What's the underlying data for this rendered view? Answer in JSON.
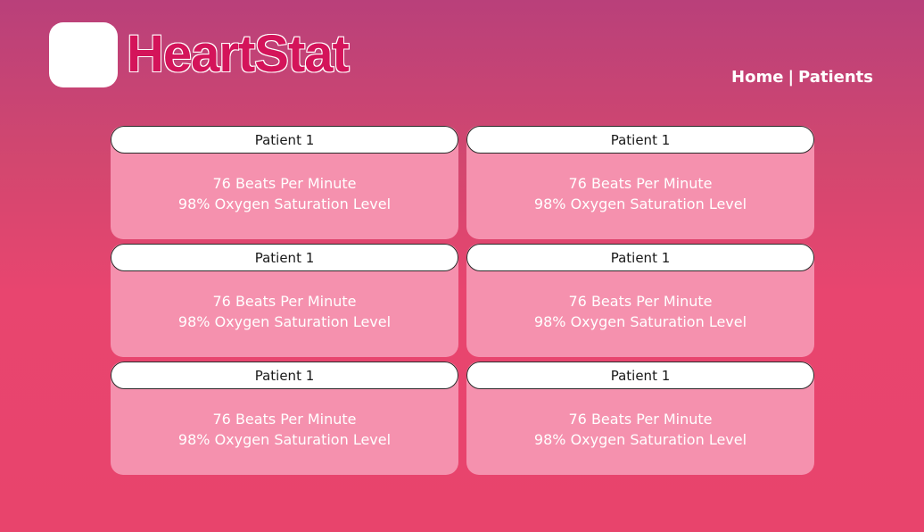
{
  "brand": {
    "name": "HeartStat",
    "color": "#d4145a"
  },
  "nav": {
    "home": "Home",
    "separator": "|",
    "patients": "Patients"
  },
  "patients": [
    {
      "name": "Patient 1",
      "heart_rate": "76 Beats Per Minute",
      "oxygen": "98% Oxygen Saturation Level"
    },
    {
      "name": "Patient 1",
      "heart_rate": "76 Beats Per Minute",
      "oxygen": "98% Oxygen Saturation Level"
    },
    {
      "name": "Patient 1",
      "heart_rate": "76 Beats Per Minute",
      "oxygen": "98% Oxygen Saturation Level"
    },
    {
      "name": "Patient 1",
      "heart_rate": "76 Beats Per Minute",
      "oxygen": "98% Oxygen Saturation Level"
    },
    {
      "name": "Patient 1",
      "heart_rate": "76 Beats Per Minute",
      "oxygen": "98% Oxygen Saturation Level"
    },
    {
      "name": "Patient 1",
      "heart_rate": "76 Beats Per Minute",
      "oxygen": "98% Oxygen Saturation Level"
    }
  ],
  "colors": {
    "background_top": "#b9407a",
    "background_bottom": "#e8446c",
    "card": "#f591ae",
    "card_header": "#ffffff"
  }
}
